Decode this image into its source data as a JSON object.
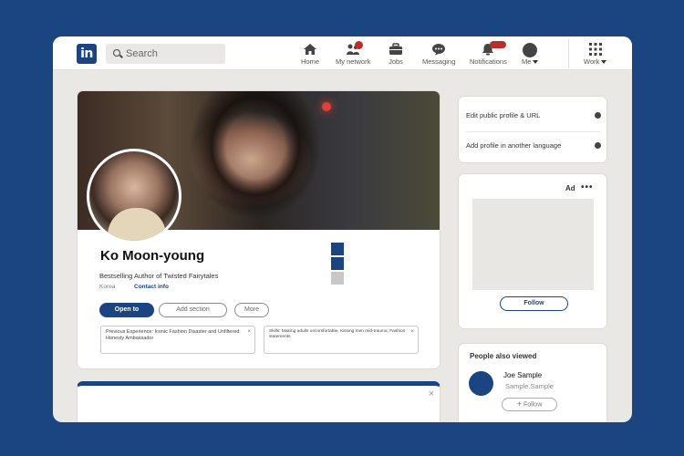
{
  "topbar": {
    "logo_text": "in",
    "search_placeholder": "Search",
    "nav": [
      {
        "label": "Home",
        "icon": "home-icon"
      },
      {
        "label": "My network",
        "icon": "network-icon"
      },
      {
        "label": "Jobs",
        "icon": "briefcase-icon"
      },
      {
        "label": "Messaging",
        "icon": "message-icon"
      },
      {
        "label": "Notifications",
        "icon": "bell-icon"
      },
      {
        "label": "Me",
        "icon": "avatar-icon"
      },
      {
        "label": "Work",
        "icon": "grid-icon"
      }
    ]
  },
  "profile": {
    "name": "Ko Moon-young",
    "headline": "Bestselling Author of Twisted Fairytales",
    "location": "Korea",
    "location_separator": "·",
    "contact_label": "Contact info",
    "buttons": {
      "open_to": "Open to",
      "add_section": "Add section",
      "more": "More"
    },
    "chips": [
      {
        "text": "Previous Experience: Iconic Fashion Disaster and Unfiltered Honesty Ambassador",
        "close": "×"
      },
      {
        "text": "Skills: Making adults uncomfortable, Kissing men mid-trauma, Fashion statements",
        "close": "×"
      }
    ]
  },
  "second_card": {
    "close": "×"
  },
  "sidebar": {
    "links": [
      {
        "label": "Edit public profile & URL"
      },
      {
        "label": "Add profile in another language"
      }
    ],
    "ad": {
      "label": "Ad",
      "more": "•••",
      "follow": "Follow"
    },
    "people_also_viewed": {
      "title": "People also viewed",
      "person": {
        "name": "Joe Sample",
        "subtitle": "Sample.Sample",
        "follow": "Follow",
        "follow_icon": "+"
      }
    }
  },
  "colors": {
    "brand": "#1b4580",
    "badge": "#b9302b",
    "page_background": "#1b4580",
    "window_background": "#eae8e4"
  }
}
